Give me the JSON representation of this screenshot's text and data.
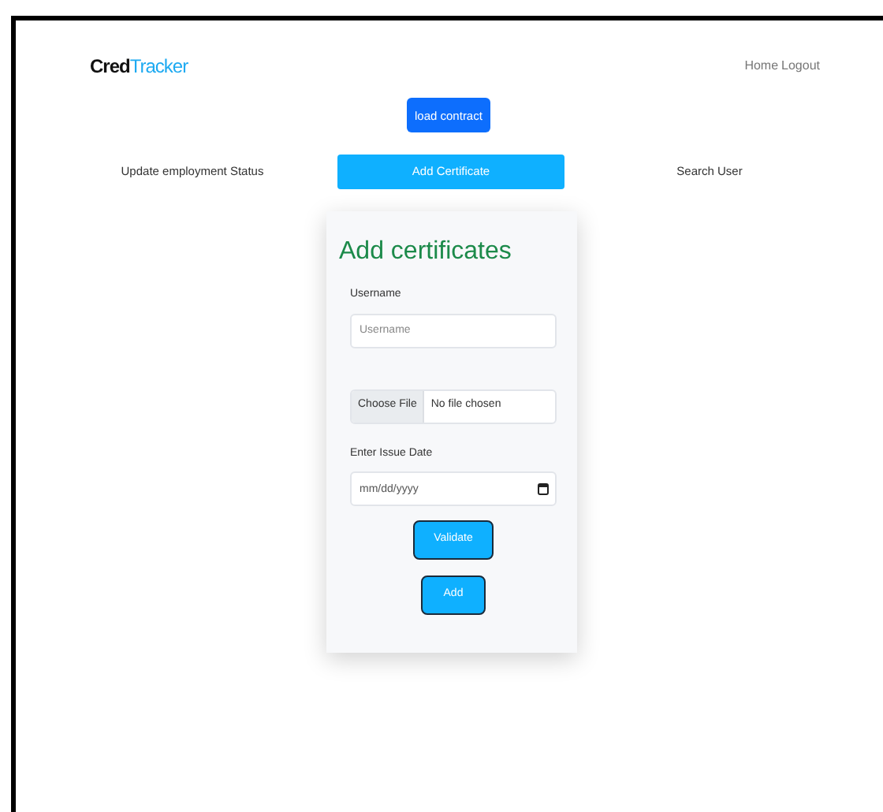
{
  "navbar": {
    "brand": [
      {
        "text": "Cred",
        "kind": "dark"
      },
      {
        "text": "Tracker",
        "kind": "accent"
      }
    ],
    "links": [
      "Home",
      "Logout"
    ]
  },
  "load_button": "load contract",
  "tabs": [
    {
      "label": "Update employment Status",
      "selected": false
    },
    {
      "label": "Add Certificate",
      "selected": true
    },
    {
      "label": "Search User",
      "selected": false
    }
  ],
  "form": {
    "title": "Add certificates",
    "username": {
      "label": "Username",
      "placeholder": "Username"
    },
    "file": {
      "button": "Choose File",
      "status": "No file chosen"
    },
    "issue_date": {
      "label": "Enter Issue Date",
      "placeholder": "mm/dd/yyyy"
    },
    "buttons": [
      "Validate",
      "Add"
    ]
  }
}
